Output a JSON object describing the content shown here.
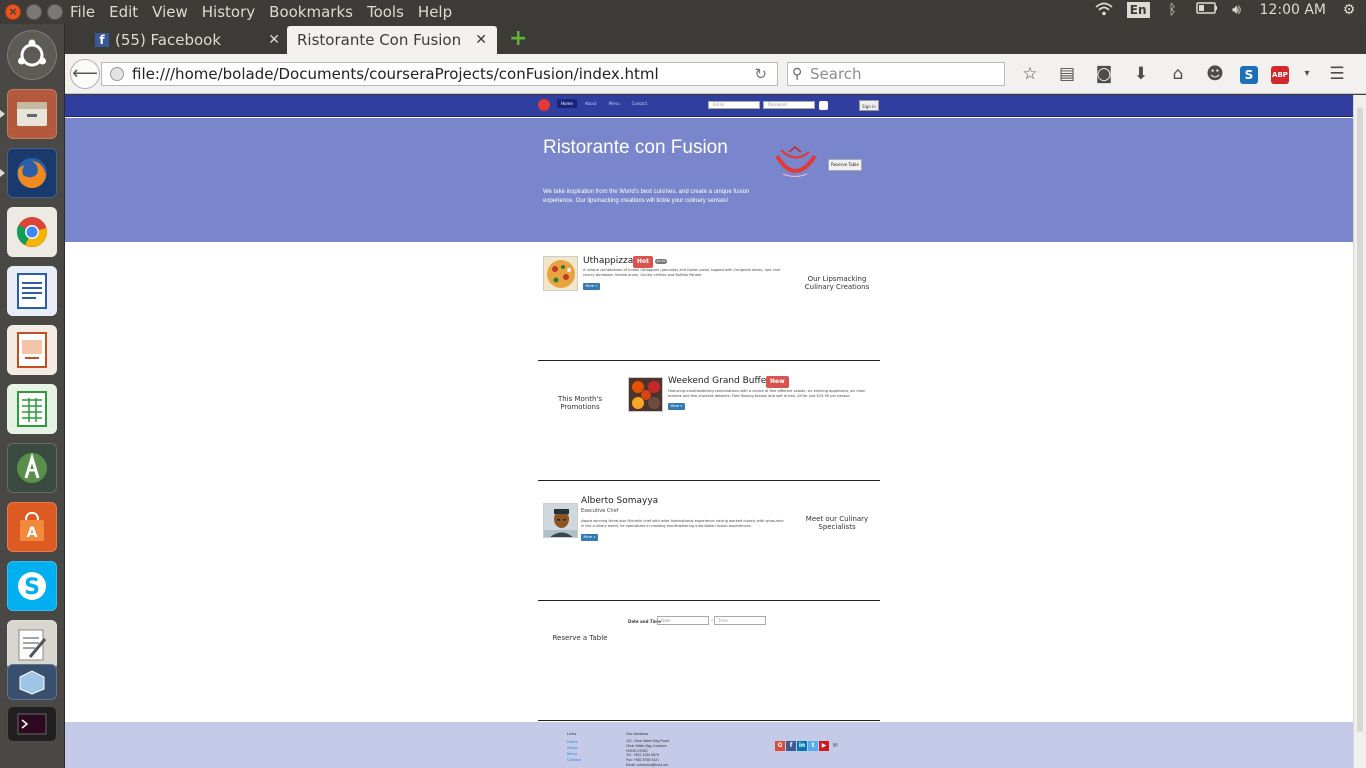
{
  "top_panel": {
    "menu": [
      "File",
      "Edit",
      "View",
      "History",
      "Bookmarks",
      "Tools",
      "Help"
    ],
    "lang": "En",
    "clock": "12:00 AM"
  },
  "browser": {
    "tabs": [
      {
        "label": "(55) Facebook"
      },
      {
        "label": "Ristorante Con Fusion"
      }
    ],
    "url": "file:///home/bolade/Documents/courseraProjects/conFusion/index.html",
    "search_placeholder": "Search",
    "abp_label": "ABP"
  },
  "site": {
    "nav": {
      "links": [
        "Home",
        "About",
        "Menu",
        "Contact"
      ],
      "email_placeholder": "Email",
      "password_placeholder": "Password",
      "signin": "Sign in"
    },
    "jumbotron": {
      "title": "Ristorante con Fusion",
      "text": "We take inspiration from the World's best cuisines, and create a unique fusion experience. Our lipsmacking creations will tickle your culinary senses!",
      "reserve_button": "Reserve Table"
    },
    "dish": {
      "title": "Uthappizza",
      "badge": "Hot",
      "price": "$4.99",
      "text": "A unique combination of Indian Uthappam (pancake) and Italian pizza, topped with Cerignola olives, ripe vine cherry tomatoes, Vidalia onion, Guntur chillies and Buffalo Paneer.",
      "more": "More »",
      "side_heading": "Our Lipsmacking Culinary Creations"
    },
    "promo": {
      "title": "Weekend Grand Buffet",
      "badge": "New",
      "text": "Featuring mouthwatering combinations with a choice of five different salads, six enticing appetizers, six main entrees and five choicest desserts. Free flowing bubbly and soft drinks. All for just $19.99 per person",
      "more": "More »",
      "side_heading": "This Month's Promotions"
    },
    "leader": {
      "name": "Alberto Somayya",
      "role": "Executive Chef",
      "text": "Award winning three-star Michelin chef with wide International experience having worked closely with whos-who in the culinary world, he specializes in creating mouthwatering Indo-Italian fusion experiences.",
      "more": "More »",
      "side_heading": "Meet our Culinary Specialists"
    },
    "reserve": {
      "heading": "Reserve a Table",
      "date_label": "Date and Time",
      "date_placeholder": "Date",
      "time_placeholder": "Time",
      "sep": "–"
    },
    "footer": {
      "links_heading": "Links",
      "links": [
        "Home",
        "About",
        "Menu",
        "Contact"
      ],
      "address_heading": "Our Address",
      "address": [
        "121, Clear Water Bay Road",
        "Clear Water Bay, Kowloon",
        "HONG KONG",
        "Tel.: +852 1234 5678",
        "Fax: +852 8765 4321",
        "Email: confusion@food.net"
      ]
    }
  },
  "colors": {
    "site_nav": "#303f9f",
    "jumbotron": "#7986cb",
    "footer": "#c5cae9",
    "ubuntu_orange": "#e95420"
  }
}
